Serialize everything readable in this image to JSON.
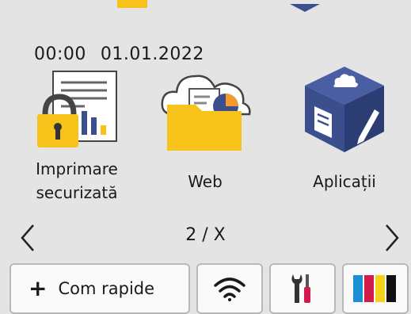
{
  "status": {
    "time": "00:00",
    "date": "01.01.2022"
  },
  "tiles": [
    {
      "label": "Imprimare\nsecurizată",
      "icon": "secure-print-icon"
    },
    {
      "label": "Web",
      "icon": "web-folder-icon"
    },
    {
      "label": "Aplicații",
      "icon": "apps-cube-icon"
    }
  ],
  "pager": {
    "indicator": "2 / X"
  },
  "bottombar": {
    "shortcuts_label": "Com rapide",
    "shortcuts_icon": "plus-icon",
    "wifi_icon": "wifi-icon",
    "settings_icon": "tools-icon",
    "ink_icon": "ink-cartridges-icon"
  },
  "colors": {
    "background": "#e4e4e4",
    "accent_yellow": "#f7c21a",
    "apps_blue": "#3b4f8f",
    "ink_cyan": "#1a8fd6",
    "ink_magenta": "#d11b4d",
    "ink_yellow": "#f4d21c",
    "ink_black": "#111111"
  }
}
